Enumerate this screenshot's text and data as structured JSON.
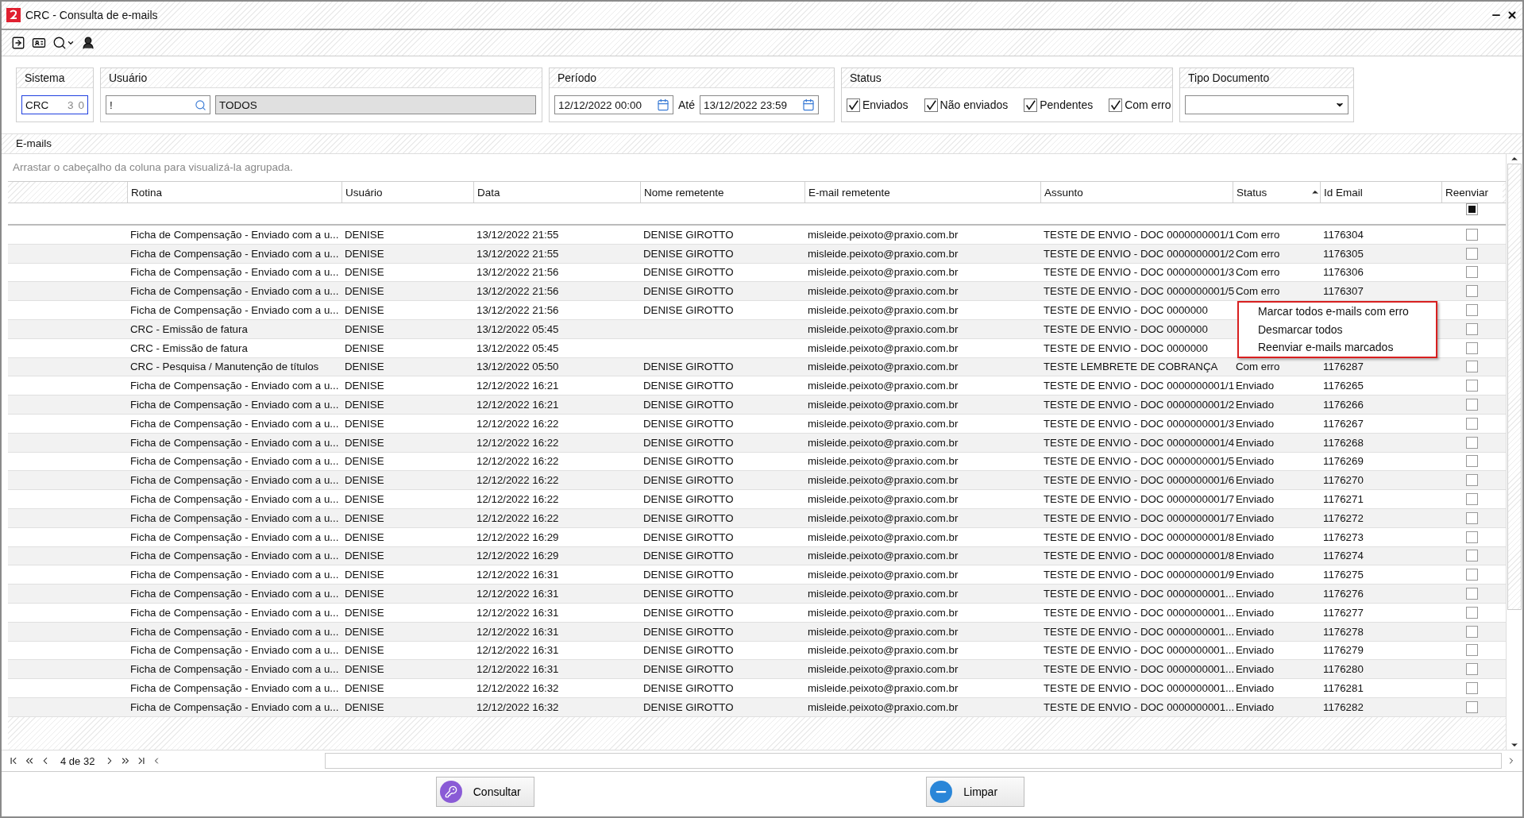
{
  "window": {
    "title": "CRC - Consulta de e-mails"
  },
  "filters": {
    "sistema": {
      "label": "Sistema",
      "value": "CRC",
      "count_1": "3",
      "count_2": "0",
      "focused": true
    },
    "usuario": {
      "label": "Usuário",
      "value": "!",
      "name": "TODOS"
    },
    "periodo": {
      "label": "Período",
      "from": "12/12/2022 00:00",
      "until_label": "Até",
      "to": "13/12/2022 23:59"
    },
    "status": {
      "label": "Status",
      "options": [
        {
          "label": "Enviados",
          "checked": true
        },
        {
          "label": "Não enviados",
          "checked": true
        },
        {
          "label": "Pendentes",
          "checked": true
        },
        {
          "label": "Com erro",
          "checked": true
        }
      ]
    },
    "tipo_documento": {
      "label": "Tipo Documento"
    }
  },
  "grid": {
    "title": "E-mails",
    "group_hint": "Arrastar o cabeçalho da coluna para visualizá-la agrupada.",
    "columns": [
      {
        "label": "Rotina",
        "sorted_ascending": false
      },
      {
        "label": "Usuário",
        "sorted_ascending": false
      },
      {
        "label": "Data",
        "sorted_ascending": false
      },
      {
        "label": "Nome remetente",
        "sorted_ascending": false
      },
      {
        "label": "E-mail remetente",
        "sorted_ascending": false
      },
      {
        "label": "Assunto",
        "sorted_ascending": false
      },
      {
        "label": "Status",
        "sorted_ascending": true
      },
      {
        "label": "Id Email",
        "sorted_ascending": false
      },
      {
        "label": "Reenviar",
        "sorted_ascending": false
      }
    ],
    "header_checkbox": {
      "indeterminate": true
    },
    "rows": [
      {
        "rotina": "Ficha de Compensação - Enviado com a u...",
        "usuario": "DENISE",
        "data": "13/12/2022 21:55",
        "nome": "DENISE GIROTTO",
        "email": "misleide.peixoto@praxio.com.br",
        "assunto": "TESTE DE ENVIO - DOC 0000000001/1",
        "status": "Com erro",
        "id": "1176304",
        "checked": false
      },
      {
        "rotina": "Ficha de Compensação - Enviado com a u...",
        "usuario": "DENISE",
        "data": "13/12/2022 21:55",
        "nome": "DENISE GIROTTO",
        "email": "misleide.peixoto@praxio.com.br",
        "assunto": "TESTE DE ENVIO - DOC 0000000001/2",
        "status": "Com erro",
        "id": "1176305",
        "checked": false
      },
      {
        "rotina": "Ficha de Compensação - Enviado com a u...",
        "usuario": "DENISE",
        "data": "13/12/2022 21:56",
        "nome": "DENISE GIROTTO",
        "email": "misleide.peixoto@praxio.com.br",
        "assunto": "TESTE DE ENVIO - DOC 0000000001/3",
        "status": "Com erro",
        "id": "1176306",
        "checked": false
      },
      {
        "rotina": "Ficha de Compensação - Enviado com a u...",
        "usuario": "DENISE",
        "data": "13/12/2022 21:56",
        "nome": "DENISE GIROTTO",
        "email": "misleide.peixoto@praxio.com.br",
        "assunto": "TESTE DE ENVIO - DOC 0000000001/5",
        "status": "Com erro",
        "id": "1176307",
        "checked": false
      },
      {
        "rotina": "Ficha de Compensação - Enviado com a u...",
        "usuario": "DENISE",
        "data": "13/12/2022 21:56",
        "nome": "DENISE GIROTTO",
        "email": "misleide.peixoto@praxio.com.br",
        "assunto": "TESTE DE ENVIO - DOC 0000000",
        "checked": false
      },
      {
        "rotina": "CRC - Emissão de fatura",
        "usuario": "DENISE",
        "data": "13/12/2022 05:45",
        "email": "misleide.peixoto@praxio.com.br",
        "assunto": "TESTE DE ENVIO - DOC 0000000",
        "checked": false
      },
      {
        "rotina": "CRC - Emissão de fatura",
        "usuario": "DENISE",
        "data": "13/12/2022 05:45",
        "email": "misleide.peixoto@praxio.com.br",
        "assunto": "TESTE DE ENVIO - DOC 0000000",
        "checked": false
      },
      {
        "rotina": "CRC - Pesquisa / Manutenção de títulos",
        "usuario": "DENISE",
        "data": "13/12/2022 05:50",
        "nome": "DENISE GIROTTO",
        "email": "misleide.peixoto@praxio.com.br",
        "assunto": "TESTE LEMBRETE DE COBRANÇA",
        "status": "Com erro",
        "id": "1176287",
        "checked": false
      },
      {
        "rotina": "Ficha de Compensação - Enviado com a u...",
        "usuario": "DENISE",
        "data": "12/12/2022 16:21",
        "nome": "DENISE GIROTTO",
        "email": "misleide.peixoto@praxio.com.br",
        "assunto": "TESTE DE ENVIO - DOC 0000000001/1",
        "status": "Enviado",
        "id": "1176265",
        "checked": false
      },
      {
        "rotina": "Ficha de Compensação - Enviado com a u...",
        "usuario": "DENISE",
        "data": "12/12/2022 16:21",
        "nome": "DENISE GIROTTO",
        "email": "misleide.peixoto@praxio.com.br",
        "assunto": "TESTE DE ENVIO - DOC 0000000001/2",
        "status": "Enviado",
        "id": "1176266",
        "checked": false
      },
      {
        "rotina": "Ficha de Compensação - Enviado com a u...",
        "usuario": "DENISE",
        "data": "12/12/2022 16:22",
        "nome": "DENISE GIROTTO",
        "email": "misleide.peixoto@praxio.com.br",
        "assunto": "TESTE DE ENVIO - DOC 0000000001/3",
        "status": "Enviado",
        "id": "1176267",
        "checked": false
      },
      {
        "rotina": "Ficha de Compensação - Enviado com a u...",
        "usuario": "DENISE",
        "data": "12/12/2022 16:22",
        "nome": "DENISE GIROTTO",
        "email": "misleide.peixoto@praxio.com.br",
        "assunto": "TESTE DE ENVIO - DOC 0000000001/4",
        "status": "Enviado",
        "id": "1176268",
        "checked": false
      },
      {
        "rotina": "Ficha de Compensação - Enviado com a u...",
        "usuario": "DENISE",
        "data": "12/12/2022 16:22",
        "nome": "DENISE GIROTTO",
        "email": "misleide.peixoto@praxio.com.br",
        "assunto": "TESTE DE ENVIO - DOC 0000000001/5",
        "status": "Enviado",
        "id": "1176269",
        "checked": false
      },
      {
        "rotina": "Ficha de Compensação - Enviado com a u...",
        "usuario": "DENISE",
        "data": "12/12/2022 16:22",
        "nome": "DENISE GIROTTO",
        "email": "misleide.peixoto@praxio.com.br",
        "assunto": "TESTE DE ENVIO - DOC 0000000001/6",
        "status": "Enviado",
        "id": "1176270",
        "checked": false
      },
      {
        "rotina": "Ficha de Compensação - Enviado com a u...",
        "usuario": "DENISE",
        "data": "12/12/2022 16:22",
        "nome": "DENISE GIROTTO",
        "email": "misleide.peixoto@praxio.com.br",
        "assunto": "TESTE DE ENVIO - DOC 0000000001/7",
        "status": "Enviado",
        "id": "1176271",
        "checked": false
      },
      {
        "rotina": "Ficha de Compensação - Enviado com a u...",
        "usuario": "DENISE",
        "data": "12/12/2022 16:22",
        "nome": "DENISE GIROTTO",
        "email": "misleide.peixoto@praxio.com.br",
        "assunto": "TESTE DE ENVIO - DOC 0000000001/7",
        "status": "Enviado",
        "id": "1176272",
        "checked": false
      },
      {
        "rotina": "Ficha de Compensação - Enviado com a u...",
        "usuario": "DENISE",
        "data": "12/12/2022 16:29",
        "nome": "DENISE GIROTTO",
        "email": "misleide.peixoto@praxio.com.br",
        "assunto": "TESTE DE ENVIO - DOC 0000000001/8",
        "status": "Enviado",
        "id": "1176273",
        "checked": false
      },
      {
        "rotina": "Ficha de Compensação - Enviado com a u...",
        "usuario": "DENISE",
        "data": "12/12/2022 16:29",
        "nome": "DENISE GIROTTO",
        "email": "misleide.peixoto@praxio.com.br",
        "assunto": "TESTE DE ENVIO - DOC 0000000001/8",
        "status": "Enviado",
        "id": "1176274",
        "checked": false
      },
      {
        "rotina": "Ficha de Compensação - Enviado com a u...",
        "usuario": "DENISE",
        "data": "12/12/2022 16:31",
        "nome": "DENISE GIROTTO",
        "email": "misleide.peixoto@praxio.com.br",
        "assunto": "TESTE DE ENVIO - DOC 0000000001/9",
        "status": "Enviado",
        "id": "1176275",
        "checked": false
      },
      {
        "rotina": "Ficha de Compensação - Enviado com a u...",
        "usuario": "DENISE",
        "data": "12/12/2022 16:31",
        "nome": "DENISE GIROTTO",
        "email": "misleide.peixoto@praxio.com.br",
        "assunto": "TESTE DE ENVIO - DOC 0000000001...",
        "status": "Enviado",
        "id": "1176276",
        "checked": false
      },
      {
        "rotina": "Ficha de Compensação - Enviado com a u...",
        "usuario": "DENISE",
        "data": "12/12/2022 16:31",
        "nome": "DENISE GIROTTO",
        "email": "misleide.peixoto@praxio.com.br",
        "assunto": "TESTE DE ENVIO - DOC 0000000001...",
        "status": "Enviado",
        "id": "1176277",
        "checked": false
      },
      {
        "rotina": "Ficha de Compensação - Enviado com a u...",
        "usuario": "DENISE",
        "data": "12/12/2022 16:31",
        "nome": "DENISE GIROTTO",
        "email": "misleide.peixoto@praxio.com.br",
        "assunto": "TESTE DE ENVIO - DOC 0000000001...",
        "status": "Enviado",
        "id": "1176278",
        "checked": false
      },
      {
        "rotina": "Ficha de Compensação - Enviado com a u...",
        "usuario": "DENISE",
        "data": "12/12/2022 16:31",
        "nome": "DENISE GIROTTO",
        "email": "misleide.peixoto@praxio.com.br",
        "assunto": "TESTE DE ENVIO - DOC 0000000001...",
        "status": "Enviado",
        "id": "1176279",
        "checked": false
      },
      {
        "rotina": "Ficha de Compensação - Enviado com a u...",
        "usuario": "DENISE",
        "data": "12/12/2022 16:31",
        "nome": "DENISE GIROTTO",
        "email": "misleide.peixoto@praxio.com.br",
        "assunto": "TESTE DE ENVIO - DOC 0000000001...",
        "status": "Enviado",
        "id": "1176280",
        "checked": false
      },
      {
        "rotina": "Ficha de Compensação - Enviado com a u...",
        "usuario": "DENISE",
        "data": "12/12/2022 16:32",
        "nome": "DENISE GIROTTO",
        "email": "misleide.peixoto@praxio.com.br",
        "assunto": "TESTE DE ENVIO - DOC 0000000001...",
        "status": "Enviado",
        "id": "1176281",
        "checked": false
      },
      {
        "rotina": "Ficha de Compensação - Enviado com a u...",
        "usuario": "DENISE",
        "data": "12/12/2022 16:32",
        "nome": "DENISE GIROTTO",
        "email": "misleide.peixoto@praxio.com.br",
        "assunto": "TESTE DE ENVIO - DOC 0000000001...",
        "status": "Enviado",
        "id": "1176282",
        "checked": false
      }
    ],
    "context_menu": {
      "items": [
        "Marcar todos e-mails com erro",
        "Desmarcar todos",
        "Reenviar e-mails marcados"
      ]
    },
    "pager": {
      "label": "4 de 32"
    }
  },
  "buttons": [
    {
      "label": "Consultar",
      "kind": "search"
    },
    {
      "label": "Limpar",
      "kind": "clear"
    }
  ]
}
